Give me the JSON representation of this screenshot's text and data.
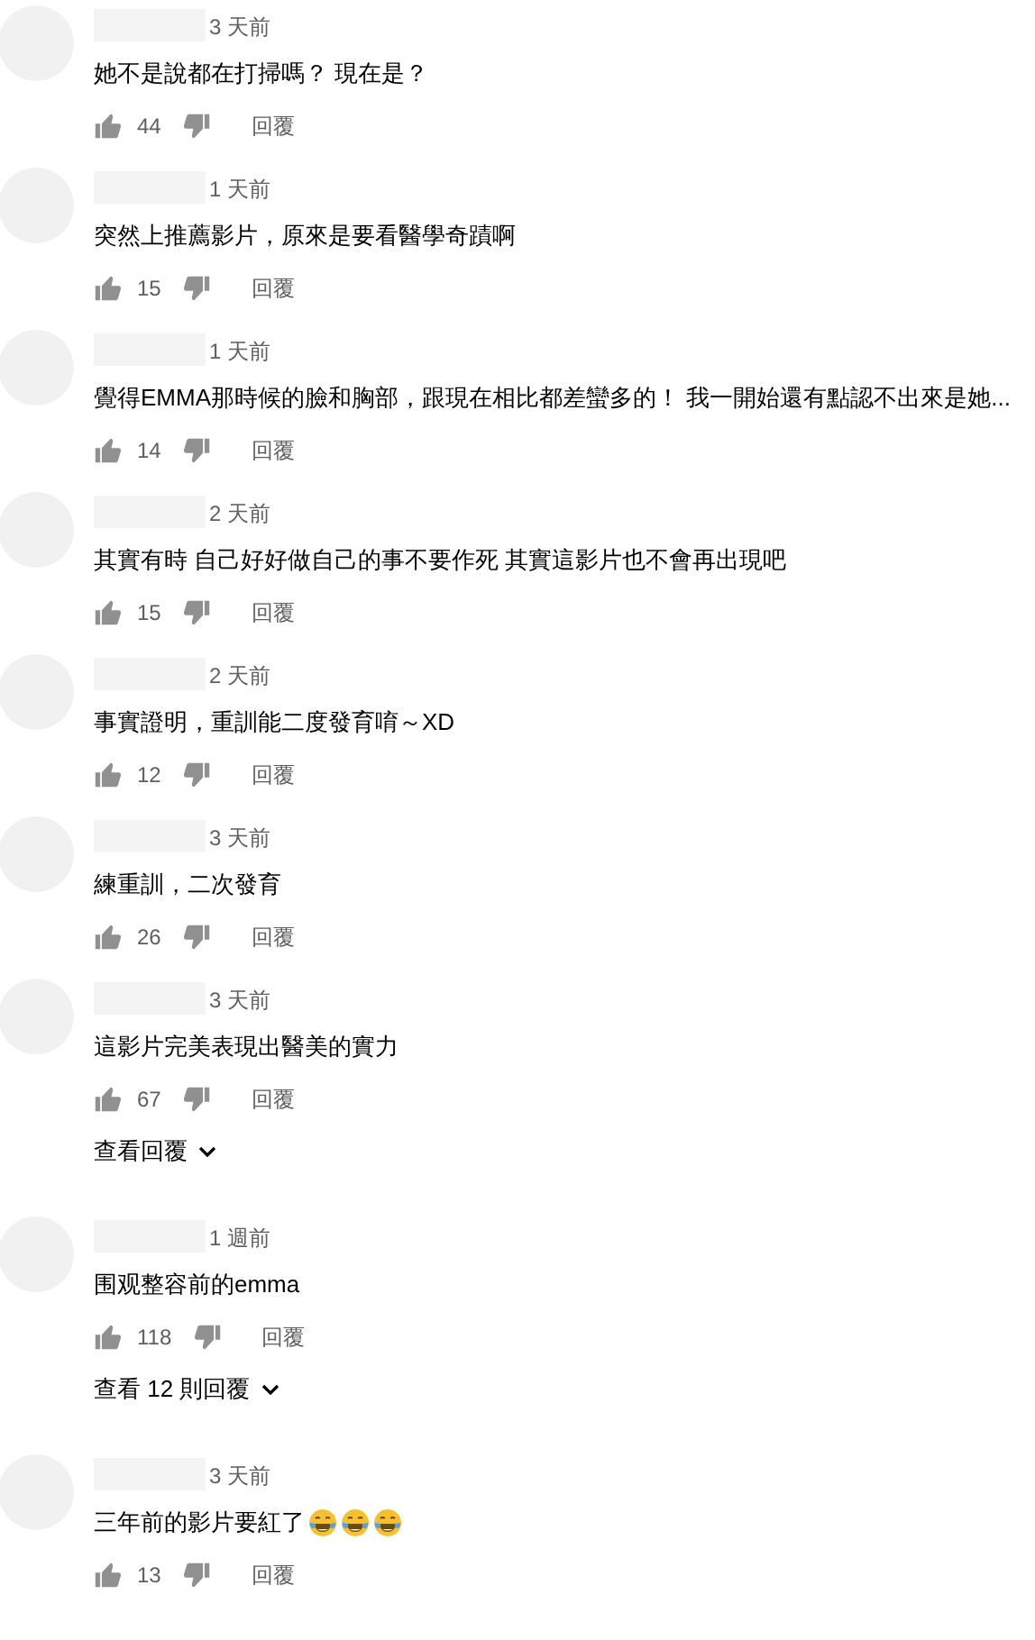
{
  "comments": [
    {
      "time": "3 天前",
      "text": "她不是說都在打掃嗎？ 現在是？",
      "likes": "44",
      "reply": "回覆"
    },
    {
      "time": "1 天前",
      "text": "突然上推薦影片，原來是要看醫學奇蹟啊",
      "likes": "15",
      "reply": "回覆"
    },
    {
      "time": "1 天前",
      "text": "覺得EMMA那時候的臉和胸部，跟現在相比都差蠻多的！ 我一開始還有點認不出來是她...",
      "likes": "14",
      "reply": "回覆"
    },
    {
      "time": "2 天前",
      "text": "其實有時 自己好好做自己的事不要作死  其實這影片也不會再出現吧",
      "likes": "15",
      "reply": "回覆"
    },
    {
      "time": "2 天前",
      "text": "事實證明，重訓能二度發育唷～XD",
      "likes": "12",
      "reply": "回覆"
    },
    {
      "time": "3 天前",
      "text": "練重訓，二次發育",
      "likes": "26",
      "reply": "回覆"
    },
    {
      "time": "3 天前",
      "text": "這影片完美表現出醫美的實力",
      "likes": "67",
      "reply": "回覆",
      "view_replies": "查看回覆"
    },
    {
      "time": "1 週前",
      "text": "围观整容前的emma",
      "likes": "118",
      "reply": "回覆",
      "view_replies": "查看 12 則回覆"
    },
    {
      "time": "3 天前",
      "text": "三年前的影片要紅了",
      "emojis": [
        {
          "kind": "tears-of-joy"
        },
        {
          "kind": "tears-of-joy"
        },
        {
          "kind": "tears-of-joy"
        }
      ],
      "likes": "13",
      "reply": "回覆"
    }
  ]
}
